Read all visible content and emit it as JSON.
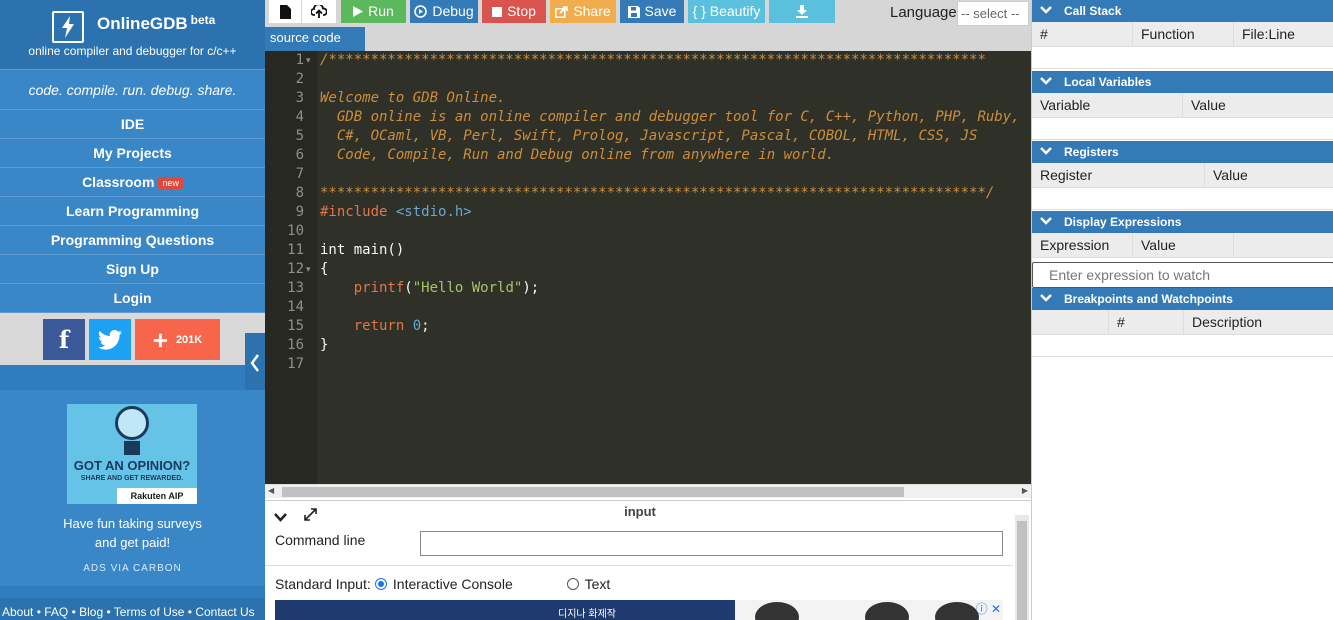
{
  "sidebar": {
    "brand": {
      "name": "OnlineGDB",
      "beta": "beta",
      "subtitle": "online compiler and debugger for c/c++"
    },
    "tagline": "code. compile. run. debug. share.",
    "nav": [
      {
        "label": "IDE"
      },
      {
        "label": "My Projects"
      },
      {
        "label": "Classroom",
        "badge": "new"
      },
      {
        "label": "Learn Programming"
      },
      {
        "label": "Programming Questions"
      },
      {
        "label": "Sign Up"
      },
      {
        "label": "Login"
      }
    ],
    "social": {
      "share_count": "201K"
    },
    "ad": {
      "headline": "GOT AN OPINION?",
      "subheadline": "SHARE AND GET REWARDED.",
      "brand": "Rakuten AIP",
      "text_line1": "Have fun taking surveys",
      "text_line2": "and get paid!",
      "via": "ADS VIA CARBON"
    },
    "footer": "About • FAQ • Blog • Terms of Use • Contact Us"
  },
  "toolbar": {
    "run": "Run",
    "debug": "Debug",
    "stop": "Stop",
    "share": "Share",
    "save": "Save",
    "beautify": "{ } Beautify",
    "language_label": "Language",
    "language_value": "-- select --"
  },
  "editor": {
    "tab": "source code",
    "line_numbers": [
      "1",
      "2",
      "3",
      "4",
      "5",
      "6",
      "7",
      "8",
      "9",
      "10",
      "11",
      "12",
      "13",
      "14",
      "15",
      "16",
      "17"
    ],
    "lines": {
      "l1": "/******************************************************************************",
      "l3": "Welcome to GDB Online.",
      "l4": "  GDB online is an online compiler and debugger tool for C, C++, Python, PHP, Ruby,",
      "l5": "  C#, OCaml, VB, Perl, Swift, Prolog, Javascript, Pascal, COBOL, HTML, CSS, JS",
      "l6": "  Code, Compile, Run and Debug online from anywhere in world.",
      "l8": "*******************************************************************************/",
      "l9_directive": "#include",
      "l9_header": "<stdio.h>",
      "l11": "int main()",
      "l12": "{",
      "l13_fn": "printf",
      "l13_open": "(",
      "l13_str": "\"Hello World\"",
      "l13_close": ");",
      "l15_kw": "return",
      "l15_num": "0",
      "l15_end": ";",
      "l16": "}"
    }
  },
  "io": {
    "title": "input",
    "command_line_label": "Command line",
    "standard_input_label": "Standard Input:",
    "option_interactive": "Interactive Console",
    "option_text": "Text",
    "ad_text": "디지나 화제작"
  },
  "debug": {
    "call_stack": {
      "title": "Call Stack",
      "columns": [
        "#",
        "Function",
        "File:Line"
      ]
    },
    "local_variables": {
      "title": "Local Variables",
      "columns": [
        "Variable",
        "Value"
      ]
    },
    "registers": {
      "title": "Registers",
      "columns": [
        "Register",
        "Value"
      ]
    },
    "display_expressions": {
      "title": "Display Expressions",
      "columns": [
        "Expression",
        "Value"
      ],
      "placeholder": "Enter expression to watch"
    },
    "breakpoints": {
      "title": "Breakpoints and Watchpoints",
      "columns": [
        "#",
        "Description"
      ]
    }
  }
}
